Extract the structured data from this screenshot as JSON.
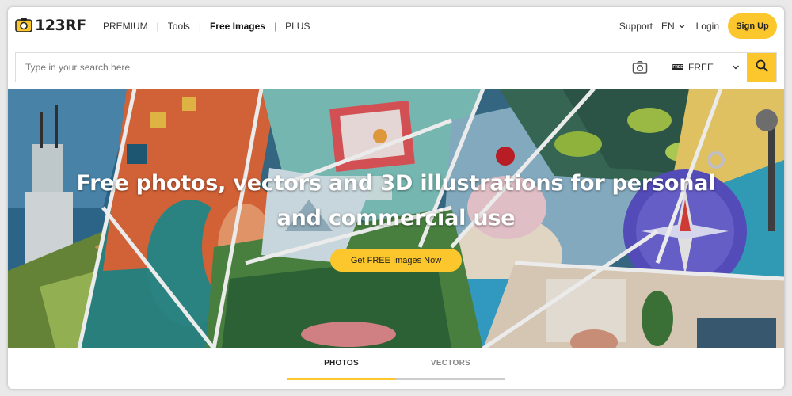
{
  "brand": {
    "name": "123RF",
    "accent_color": "#fcc72c"
  },
  "nav": {
    "links": [
      {
        "label": "PREMIUM",
        "bold": false
      },
      {
        "label": "Tools",
        "bold": false
      },
      {
        "label": "Free Images",
        "bold": true
      },
      {
        "label": "PLUS",
        "bold": false
      }
    ],
    "support": "Support",
    "language": "EN",
    "login": "Login",
    "signup": "Sign Up"
  },
  "search": {
    "placeholder": "Type in your search here",
    "filter_badge": "FREE",
    "filter_value": "FREE",
    "icons": [
      "camera-icon",
      "chevron-down-icon",
      "search-icon"
    ]
  },
  "hero": {
    "title_line1": "Free photos, vectors and 3D illustrations for personal",
    "title_line2": "and commercial use",
    "cta": "Get FREE Images Now"
  },
  "tabs": [
    {
      "label": "PHOTOS",
      "active": true
    },
    {
      "label": "VECTORS",
      "active": false
    }
  ]
}
